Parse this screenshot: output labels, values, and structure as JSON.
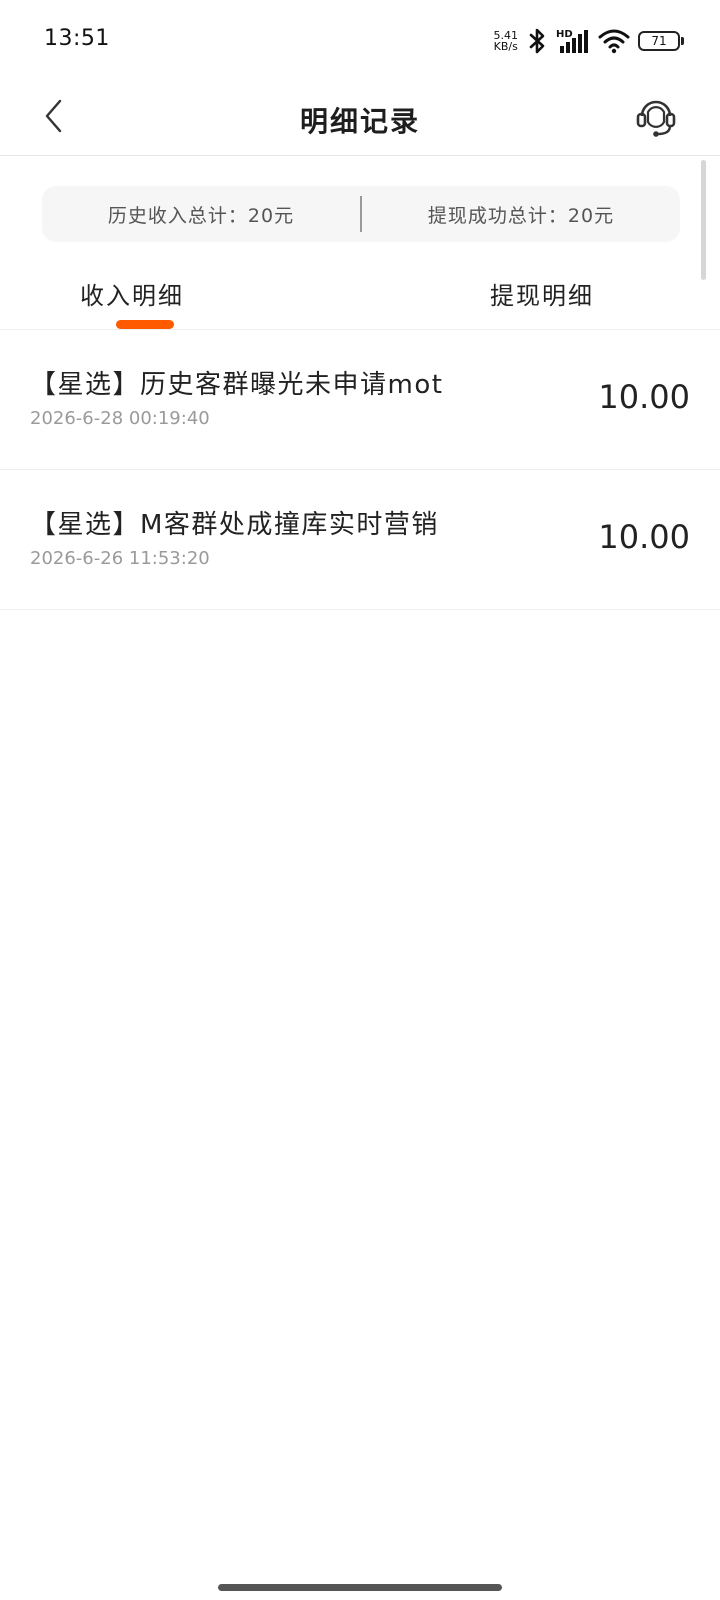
{
  "status_bar": {
    "time": "13:51",
    "net_speed_value": "5.41",
    "net_speed_unit": "KB/s",
    "battery": "71",
    "icons": [
      "bluetooth-icon",
      "signal-icon",
      "wifi-icon",
      "battery-icon"
    ],
    "hd_label": "HD"
  },
  "nav": {
    "title": "明细记录",
    "back_icon": "chevron-left-icon",
    "support_icon": "headset-icon"
  },
  "summary": {
    "income_total": "历史收入总计：20元",
    "withdraw_total": "提现成功总计：20元"
  },
  "tabs": {
    "active": "income",
    "items": [
      {
        "key": "income",
        "label": "收入明细"
      },
      {
        "key": "withdraw",
        "label": "提现明细"
      }
    ],
    "accent_color": "#ff5a00"
  },
  "records": [
    {
      "title": "【星选】历史客群曝光未申请mot",
      "time": "2026-6-28 00:19:40",
      "amount": "10.00"
    },
    {
      "title": "【星选】M客群处成撞库实时营销",
      "time": "2026-6-26 11:53:20",
      "amount": "10.00"
    }
  ]
}
